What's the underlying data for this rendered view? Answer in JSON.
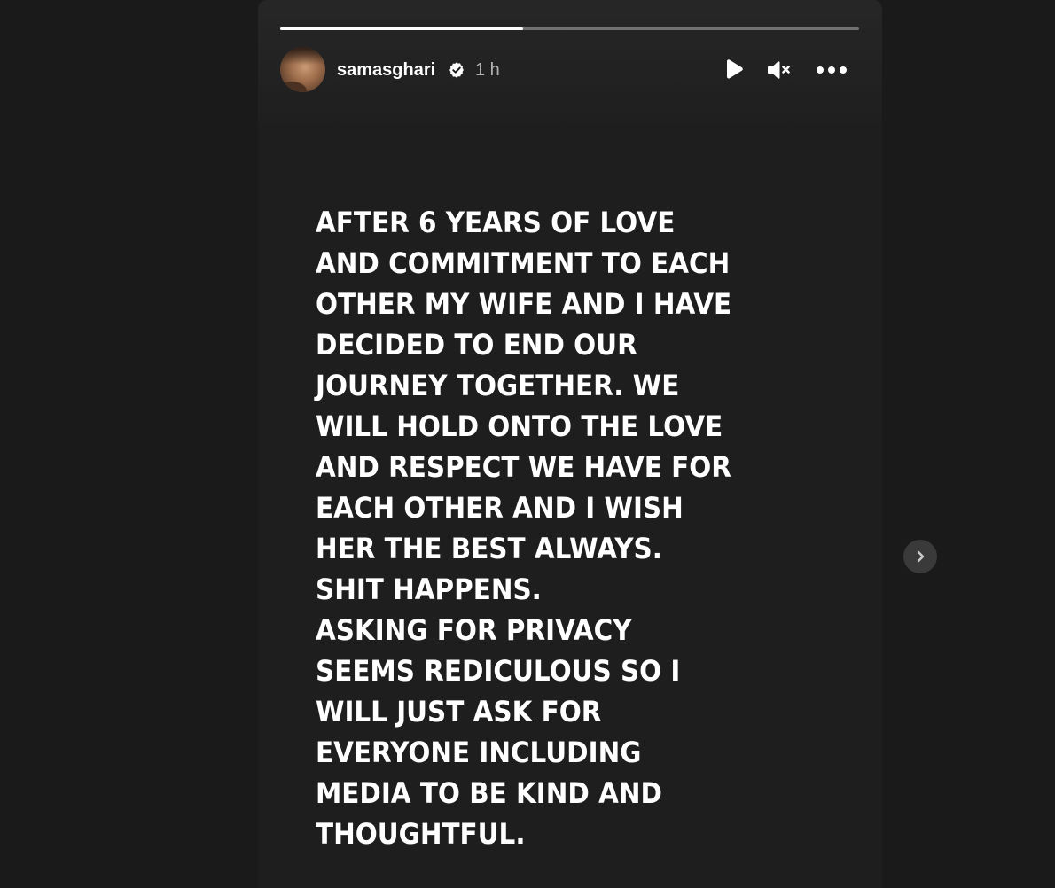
{
  "story": {
    "progress": 0.42,
    "username": "samasghari",
    "verified_icon": "verified-badge-icon",
    "time": "1 h",
    "controls": {
      "play_icon": "play-icon",
      "mute_icon": "muted-speaker-icon",
      "more_icon": "more-options-icon"
    },
    "text": "AFTER 6 YEARS OF LOVE\nAND COMMITMENT TO EACH\nOTHER MY WIFE AND I HAVE\nDECIDED TO END OUR\nJOURNEY TOGETHER. WE\nWILL HOLD ONTO THE LOVE\nAND RESPECT WE HAVE FOR\nEACH OTHER AND I WISH\nHER THE BEST ALWAYS.\nSHIT HAPPENS.\nASKING FOR PRIVACY\nSEEMS REDICULOUS SO I\nWILL JUST ASK FOR\nEVERYONE INCLUDING\nMEDIA TO BE KIND AND\nTHOUGHTFUL."
  },
  "navigation": {
    "next_icon": "chevron-right-icon"
  },
  "colors": {
    "background": "#1a1a1a",
    "story_background": "#1e1e1e",
    "text": "#ffffff",
    "secondary_text": "#a6a6a6"
  }
}
